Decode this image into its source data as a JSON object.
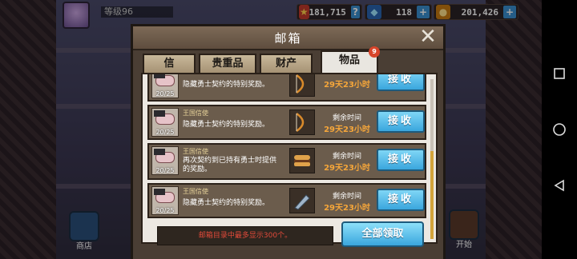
{
  "hud": {
    "level": "等级96",
    "gold_stars": "181,715",
    "gems": "118",
    "coins": "201,426"
  },
  "bottom": {
    "shop_label": "商店",
    "start_label": "开始"
  },
  "modal": {
    "title": "邮箱",
    "tabs": [
      {
        "label": "信"
      },
      {
        "label": "贵重品"
      },
      {
        "label": "财产"
      },
      {
        "label": "物品",
        "badge": "9"
      }
    ],
    "mails": [
      {
        "count": "20/25",
        "sender": "",
        "text": "隐藏勇士契约的特别奖励。",
        "remain_label": "",
        "remain": "29天23小时",
        "claim": "接收"
      },
      {
        "count": "20/25",
        "sender": "王国信使",
        "text": "隐藏勇士契约的特别奖励。",
        "remain_label": "剩余时间",
        "remain": "29天23小时",
        "claim": "接收"
      },
      {
        "count": "20/25",
        "sender": "王国信使",
        "text": "再次契约到已持有勇士时提供的奖励。",
        "remain_label": "剩余时间",
        "remain": "29天23小时",
        "claim": "接收"
      },
      {
        "count": "20/25",
        "sender": "王国信使",
        "text": "隐藏勇士契约的特别奖励。",
        "remain_label": "剩余时间",
        "remain": "29天23小时",
        "claim": "接收"
      }
    ],
    "note": "邮箱目录中最多显示300个。",
    "claim_all": "全部领取"
  }
}
